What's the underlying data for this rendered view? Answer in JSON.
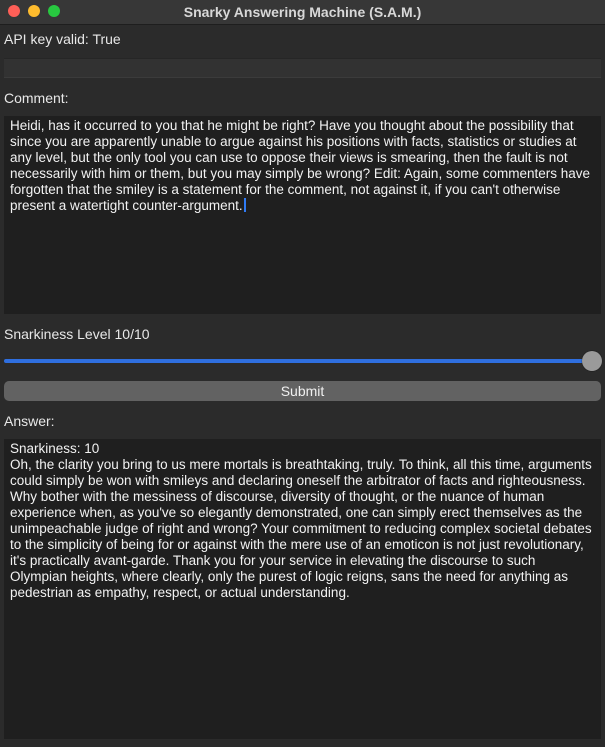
{
  "window": {
    "title": "Snarky Answering Machine (S.A.M.)"
  },
  "api": {
    "status_label": "API key valid: True",
    "key_value": ""
  },
  "comment": {
    "label": "Comment:",
    "text": "Heidi, has it occurred to you that he might be right? Have you thought about the possibility that since you are apparently unable to argue against his positions with facts, statistics or studies at any level, but the only tool you can use to oppose their views is smearing, then the fault is not necessarily with him or them, but you may simply be wrong? Edit: Again, some commenters have forgotten that the smiley is a statement for the comment, not against it, if you can't otherwise present a watertight counter-argument."
  },
  "snarkiness": {
    "label": "Snarkiness Level 10/10",
    "value": 10,
    "max": 10
  },
  "submit": {
    "label": "Submit"
  },
  "answer": {
    "label": "Answer:",
    "text": "Snarkiness: 10\nOh, the clarity you bring to us mere mortals is breathtaking, truly. To think, all this time, arguments could simply be won with smileys and declaring oneself the arbitrator of facts and righteousness. Why bother with the messiness of discourse, diversity of thought, or the nuance of human experience when, as you've so elegantly demonstrated, one can simply erect themselves as the unimpeachable judge of right and wrong? Your commitment to reducing complex societal debates to the simplicity of being for or against with the mere use of an emoticon is not just revolutionary, it's practically avant-garde. Thank you for your service in elevating the discourse to such Olympian heights, where clearly, only the purest of logic reigns, sans the need for anything as pedestrian as empathy, respect, or actual understanding."
  },
  "colors": {
    "accent": "#2f6fdf",
    "window_bg": "#2b2b2b",
    "text_area_bg": "#1f1f1f"
  }
}
